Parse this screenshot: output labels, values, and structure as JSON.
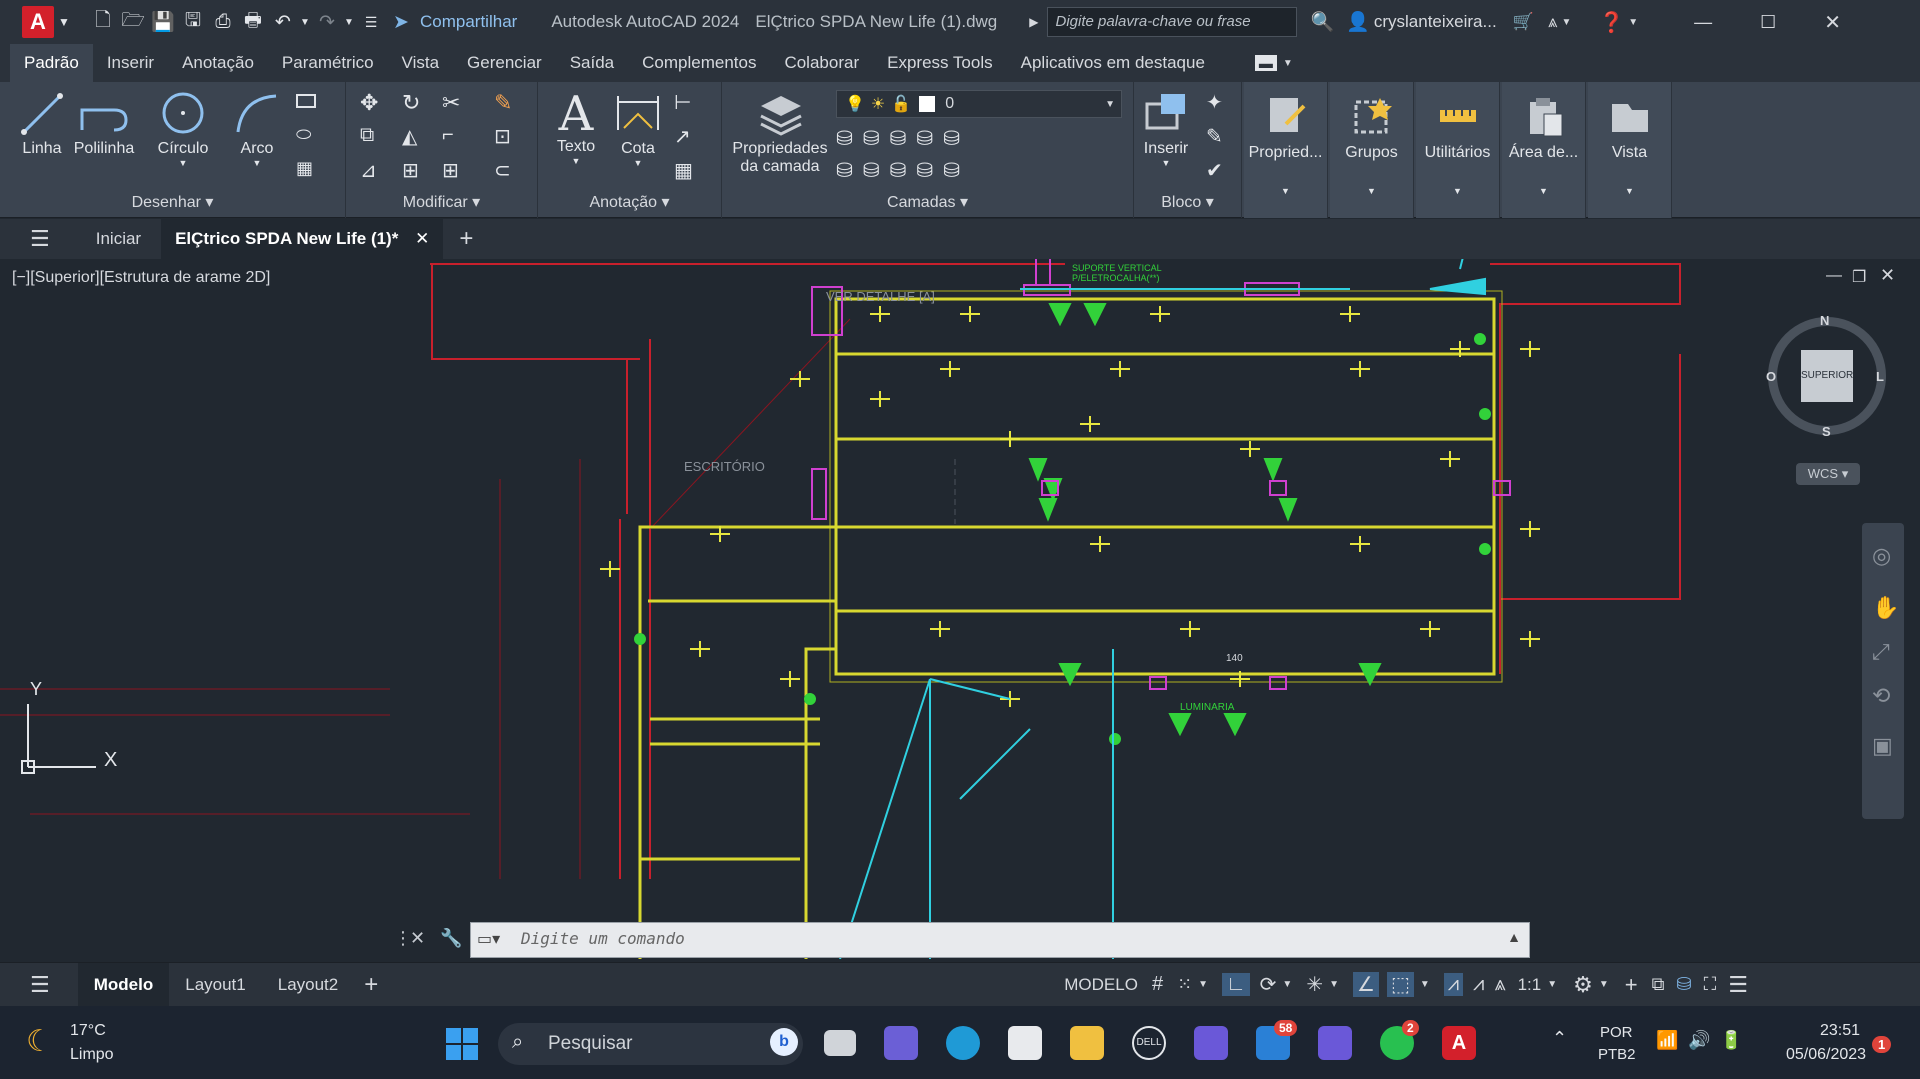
{
  "titlebar": {
    "share_label": "Compartilhar",
    "app_title": "Autodesk AutoCAD 2024",
    "file_name": "ElÇtrico SPDA New Life (1).dwg",
    "search_placeholder": "Digite palavra-chave ou frase",
    "user_name": "cryslanteixeira..."
  },
  "menu": {
    "tabs": [
      "Padrão",
      "Inserir",
      "Anotação",
      "Paramétrico",
      "Vista",
      "Gerenciar",
      "Saída",
      "Complementos",
      "Colaborar",
      "Express Tools",
      "Aplicativos em destaque"
    ]
  },
  "ribbon": {
    "draw": {
      "title": "Desenhar",
      "linha": "Linha",
      "polilinha": "Polilinha",
      "circulo": "Círculo",
      "arco": "Arco"
    },
    "modify": {
      "title": "Modificar"
    },
    "annotation": {
      "title": "Anotação",
      "texto": "Texto",
      "cota": "Cota"
    },
    "layers": {
      "title": "Camadas",
      "props_line1": "Propriedades",
      "props_line2": "da camada",
      "current_layer": "0"
    },
    "block": {
      "title": "Bloco",
      "inserir": "Inserir"
    },
    "panels": {
      "propried": "Propried...",
      "grupos": "Grupos",
      "utilitarios": "Utilitários",
      "area": "Área de...",
      "vista": "Vista"
    }
  },
  "filetabs": {
    "iniciar": "Iniciar",
    "active": "ElÇtrico SPDA New Life (1)*"
  },
  "viewport": {
    "label": "[−][Superior][Estrutura de arame 2D]",
    "viewcube_top": "SUPERIOR",
    "n": "N",
    "s": "S",
    "o": "O",
    "l": "L",
    "wcs": "WCS",
    "annot_escritorio": "ESCRITÓRIO",
    "annot_detalhe": "VER DETALHE [A]",
    "annot_suporte": "SUPORTE VERTICAL P/ELETROCALHA(**)",
    "annot_luminaria": "LUMINARIA",
    "annot_dim": "140",
    "ucs_x": "X",
    "ucs_y": "Y"
  },
  "command": {
    "placeholder": "Digite um comando"
  },
  "statusbar": {
    "tabs": [
      "Modelo",
      "Layout1",
      "Layout2"
    ],
    "modelo_label": "MODELO",
    "scale": "1:1"
  },
  "taskbar": {
    "weather_temp": "17°C",
    "weather_desc": "Limpo",
    "search_label": "Pesquisar",
    "mail_badge": "58",
    "whatsapp_badge": "2",
    "lang_line1": "POR",
    "lang_line2": "PTB2",
    "time": "23:51",
    "date": "05/06/2023",
    "notif_badge": "1"
  }
}
